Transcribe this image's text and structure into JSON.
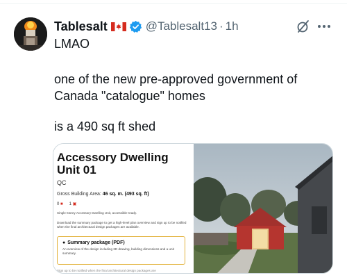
{
  "tweet": {
    "author_name": "Tablesalt",
    "handle": "@Tablesalt13",
    "separator": "·",
    "timestamp": "1h",
    "lines": [
      "LMAO",
      "one of the new pre-approved government of",
      "Canada \"catalogue\" homes",
      "is a 490 sq ft shed"
    ]
  },
  "icons": {
    "flag": "canada-flag-icon",
    "verified": "verified-badge-icon",
    "grok": "grok-icon",
    "more": "more-options-icon"
  },
  "colors": {
    "text": "#0f1419",
    "secondary_text": "#536471",
    "verified_blue": "#1d9bf0",
    "flag_red": "#d52b1e",
    "summary_border": "#e3b33d",
    "media_border": "#cfd9de"
  },
  "media": {
    "title": "Accessory Dwelling Unit 01",
    "province": "QC",
    "area_label": "Gross Building Area:",
    "area_value": "46 sq. m. (493 sq. ft)",
    "bedrooms": "0",
    "bathrooms": "1",
    "description": "Single-storey Accessory Dwelling Unit, accessible-ready.",
    "download_text": "Download the summary package to get a high-level plan overview and sign up to be notified when the final architectural design packages are available.",
    "summary_title": "Summary package (PDF)",
    "summary_text": "An overview of the design including 3D drawing, building dimensions and a unit summary.",
    "footer_text": "Sign up to be notified when the final architectural design packages are"
  }
}
